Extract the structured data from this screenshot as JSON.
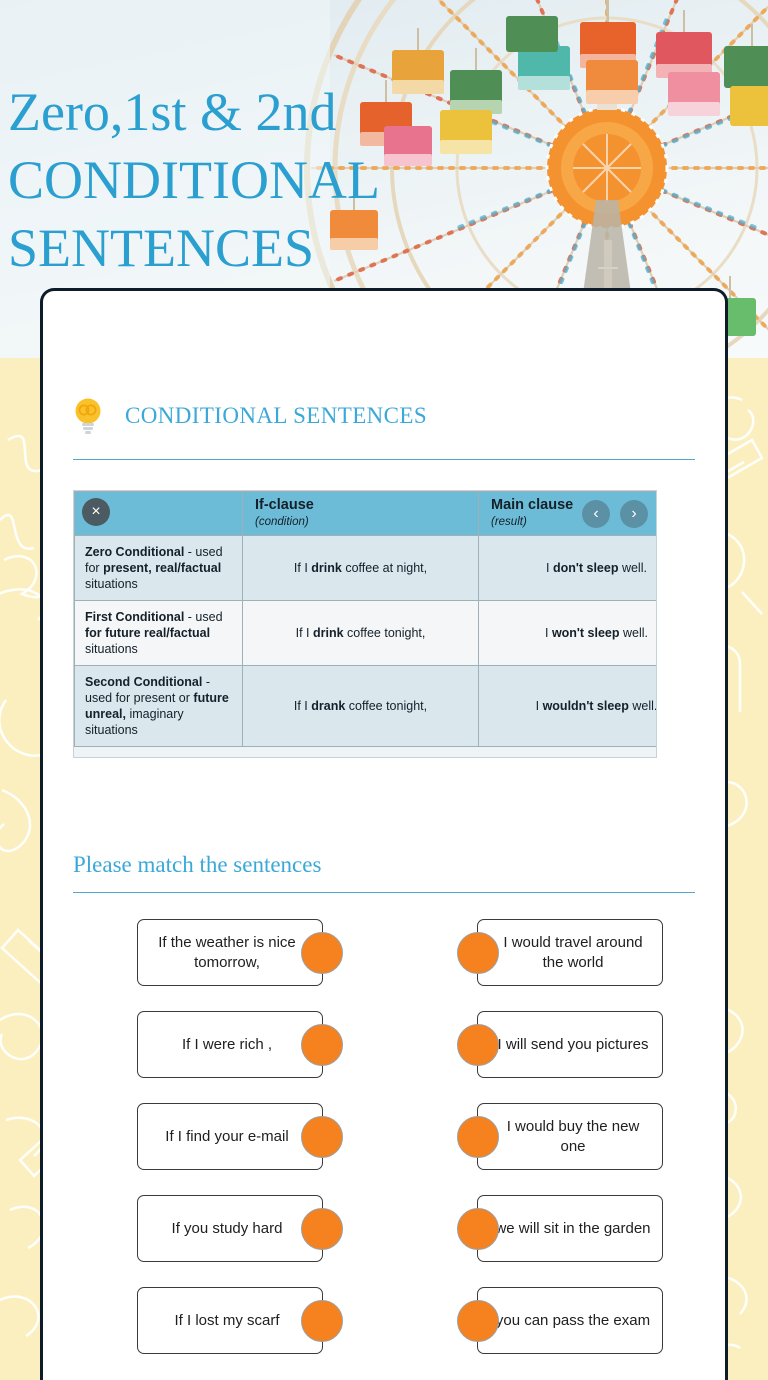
{
  "hero": {
    "title": "Zero,1st & 2nd\nCONDITIONAL\nSENTENCES",
    "accent_color": "#2a9fd0",
    "image_subject": "ferris-wheel-photo"
  },
  "section": {
    "icon": "lightbulb-icon",
    "title": "CONDITIONAL SENTENCES"
  },
  "table": {
    "close_label": "×",
    "prev_label": "‹",
    "next_label": "›",
    "headers": [
      {
        "title": "",
        "sub": ""
      },
      {
        "title": "If-clause",
        "sub": "(condition)"
      },
      {
        "title": "Main clause",
        "sub": "(result)"
      }
    ],
    "rows": [
      {
        "type_bold": "Zero Conditional",
        "type_rest": " - used for ",
        "type_b2": "present,",
        "type_b3": "real/factual",
        "type_tail": " situations",
        "if_pre": "If I ",
        "if_bold": "drink",
        "if_post": " coffee at night,",
        "main_pre": "I ",
        "main_bold": "don't sleep",
        "main_post": " well."
      },
      {
        "type_bold": "First Conditional",
        "type_rest": " - used ",
        "type_b2": "for future",
        "type_b3": "real/factual",
        "type_tail": " situations",
        "if_pre": "If I ",
        "if_bold": "drink",
        "if_post": " coffee tonight,",
        "main_pre": "I ",
        "main_bold": "won't sleep",
        "main_post": " well."
      },
      {
        "type_bold": "Second Conditional",
        "type_rest": " - used for present or ",
        "type_b2": "future unreal,",
        "type_b3": "imaginary",
        "type_tail": " situations",
        "if_pre": "If I ",
        "if_bold": "drank",
        "if_post": " coffee tonight,",
        "main_pre": "I ",
        "main_bold": "wouldn't sleep",
        "main_post": " well."
      }
    ]
  },
  "exercise": {
    "title": "Please match the sentences",
    "dot_color": "#f5821f",
    "pairs": [
      {
        "left": "If the weather is nice tomorrow,",
        "right": "I would travel around the world"
      },
      {
        "left": "If I were rich ,",
        "right": "I will send you pictures"
      },
      {
        "left": "If I find your e-mail",
        "right": "I would buy the new one"
      },
      {
        "left": "If you study hard",
        "right": "we will sit in the garden"
      },
      {
        "left": "If I lost my scarf",
        "right": "you can pass the exam"
      }
    ]
  }
}
